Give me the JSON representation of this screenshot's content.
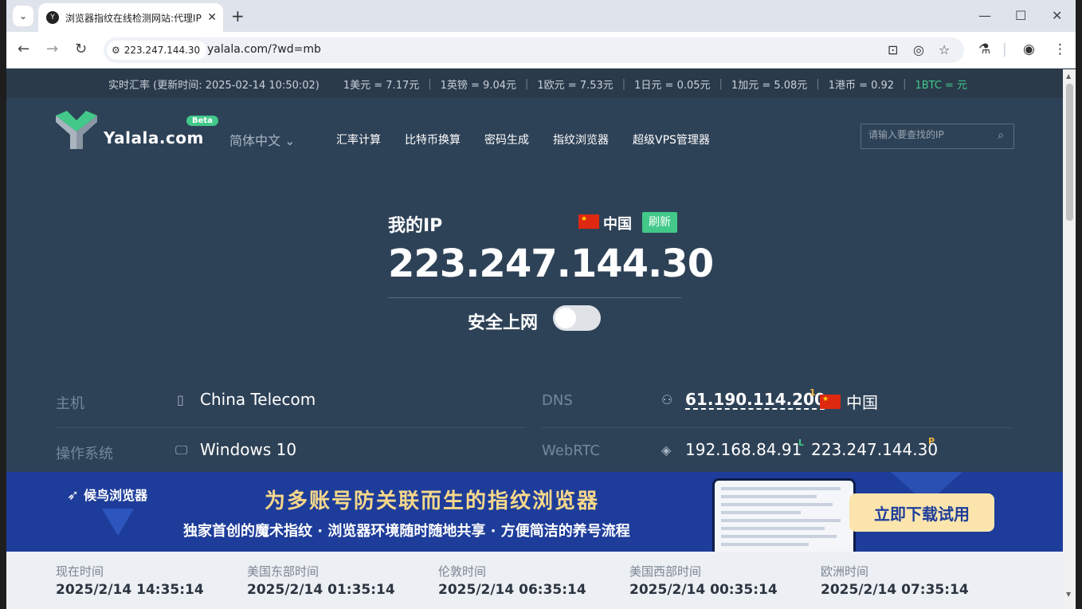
{
  "tab": {
    "title": "浏览器指纹在线检测网站:代理IP",
    "favicon": "Y"
  },
  "toolbar": {
    "site_chip": "223.247.144.30",
    "url": "yalala.com/?wd=mb"
  },
  "ratebar": {
    "timestamp": "实时汇率 (更新时间: 2025-02-14 10:50:02)",
    "rates": [
      "1美元 = 7.17元",
      "1英镑 = 9.04元",
      "1欧元 = 7.53元",
      "1日元 = 0.05元",
      "1加元 = 5.08元",
      "1港币 = 0.92"
    ],
    "btc": "1BTC = 元"
  },
  "header": {
    "logo": "Yalala.com",
    "beta": "Beta",
    "lang": "简体中文 ⌄",
    "menu": [
      "汇率计算",
      "比特币换算",
      "密码生成",
      "指纹浏览器",
      "超级VPS管理器"
    ],
    "search_placeholder": "请输入要查找的IP"
  },
  "ip": {
    "label": "我的IP",
    "country": "中国",
    "refresh": "刷新",
    "address": "223.247.144.30",
    "safe_label": "安全上网"
  },
  "info": {
    "host_label": "主机",
    "host_value": "China Telecom",
    "os_label": "操作系统",
    "os_value": "Windows 10",
    "dns_label": "DNS",
    "dns_ip": "61.190.114.200",
    "dns_sup": "1",
    "dns_country": "中国",
    "webrtc_label": "WebRTC",
    "webrtc_local": "192.168.84.91",
    "webrtc_local_tag": "L",
    "webrtc_public": "223.247.144.30",
    "webrtc_public_tag": "P"
  },
  "banner": {
    "brand": "候鸟浏览器",
    "title": "为多账号防关联而生的指纹浏览器",
    "subtitle": "独家首创的魔术指纹 · 浏览器环境随时随地共享 · 方便简洁的养号流程",
    "cta": "立即下载试用"
  },
  "clocks": [
    {
      "label": "现在时间",
      "time": "2025/2/14 14:35:14"
    },
    {
      "label": "美国东部时间",
      "time": "2025/2/14 01:35:14"
    },
    {
      "label": "伦敦时间",
      "time": "2025/2/14 06:35:14"
    },
    {
      "label": "美国西部时间",
      "time": "2025/2/14 00:35:14"
    },
    {
      "label": "欧洲时间",
      "time": "2025/2/14 07:35:14"
    }
  ],
  "colors": {
    "page_bg": "#2e4257",
    "accent_green": "#42c98a",
    "banner_bg": "#1e3d9a",
    "cta_bg": "#fbe5ad"
  }
}
